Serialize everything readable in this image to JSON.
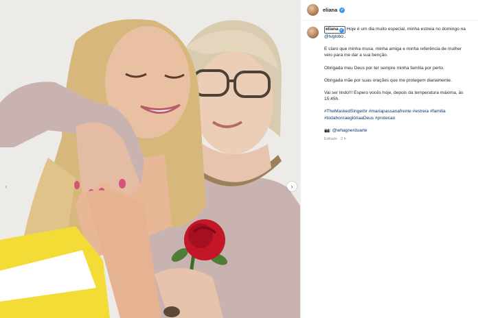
{
  "post": {
    "username": "eliana",
    "verified_badge": "✓",
    "carousel_next_icon": "›",
    "carousel_prev_icon": "‹"
  },
  "caption": {
    "username": "eliana",
    "line1_text": " Hoje é um dia muito especial, minha estreia no domingo na ",
    "line1_mention": "@tvglobo",
    "line1_end": " .",
    "para2": "E claro que minha musa, minha amiga e minha referência de mulher veio para me dar a sua benção.",
    "para3": "Obrigada meu Deus por ter sempre minha família por perto.",
    "para4": "Obrigada mãe por suas orações que me protegem diariamente.",
    "para5": "Vai ser lindo!!! Espero vocês hoje, depois da temperatura máxima, às 15:45h.",
    "hashtags": "#TheMaskedSingerbr #mariapassanafrente #estreia #familia #todahonraeglóriaaDeus #protecao",
    "credit_icon": "📷",
    "credit_mention": ": @whagnerduarte",
    "edited_label": "Editado · 2 h"
  },
  "colors": {
    "link": "#00376b",
    "verified": "#3897f0",
    "muted": "#8e8e8e"
  }
}
